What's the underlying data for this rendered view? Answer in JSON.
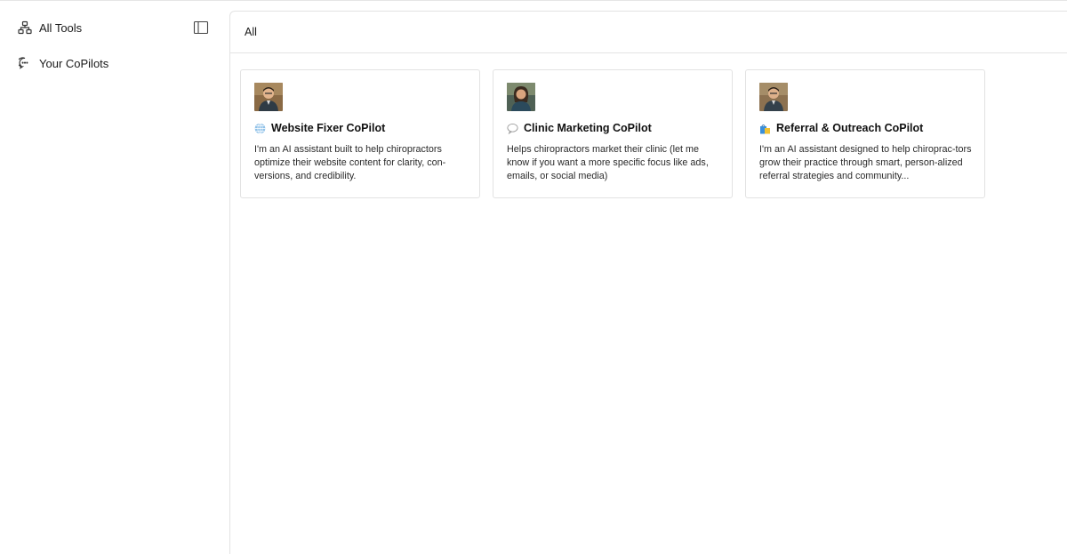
{
  "sidebar": {
    "items": [
      {
        "label": "All Tools",
        "icon": "sitemap-icon"
      },
      {
        "label": "Your CoPilots",
        "icon": "chat-bubble-icon"
      }
    ],
    "collapse_icon": "sidebar-toggle-icon"
  },
  "main": {
    "tabs": [
      {
        "label": "All"
      }
    ],
    "cards": [
      {
        "title": "Website Fixer CoPilot",
        "title_icon": "globe-icon",
        "description": "I'm an AI assistant built to help chiropractors optimize their website content for clarity, con-versions, and credibility."
      },
      {
        "title": "Clinic Marketing CoPilot",
        "title_icon": "speech-bubble-icon",
        "description": "Helps chiropractors market their clinic (let me know if you want a more specific focus like ads, emails, or social media)"
      },
      {
        "title": "Referral & Outreach CoPilot",
        "title_icon": "shopping-bags-icon",
        "description": "I'm an AI assistant designed to help chiroprac-tors grow their practice through smart, person-alized referral strategies and community..."
      }
    ]
  },
  "colors": {
    "border": "#e2e2e2",
    "text": "#111111"
  }
}
